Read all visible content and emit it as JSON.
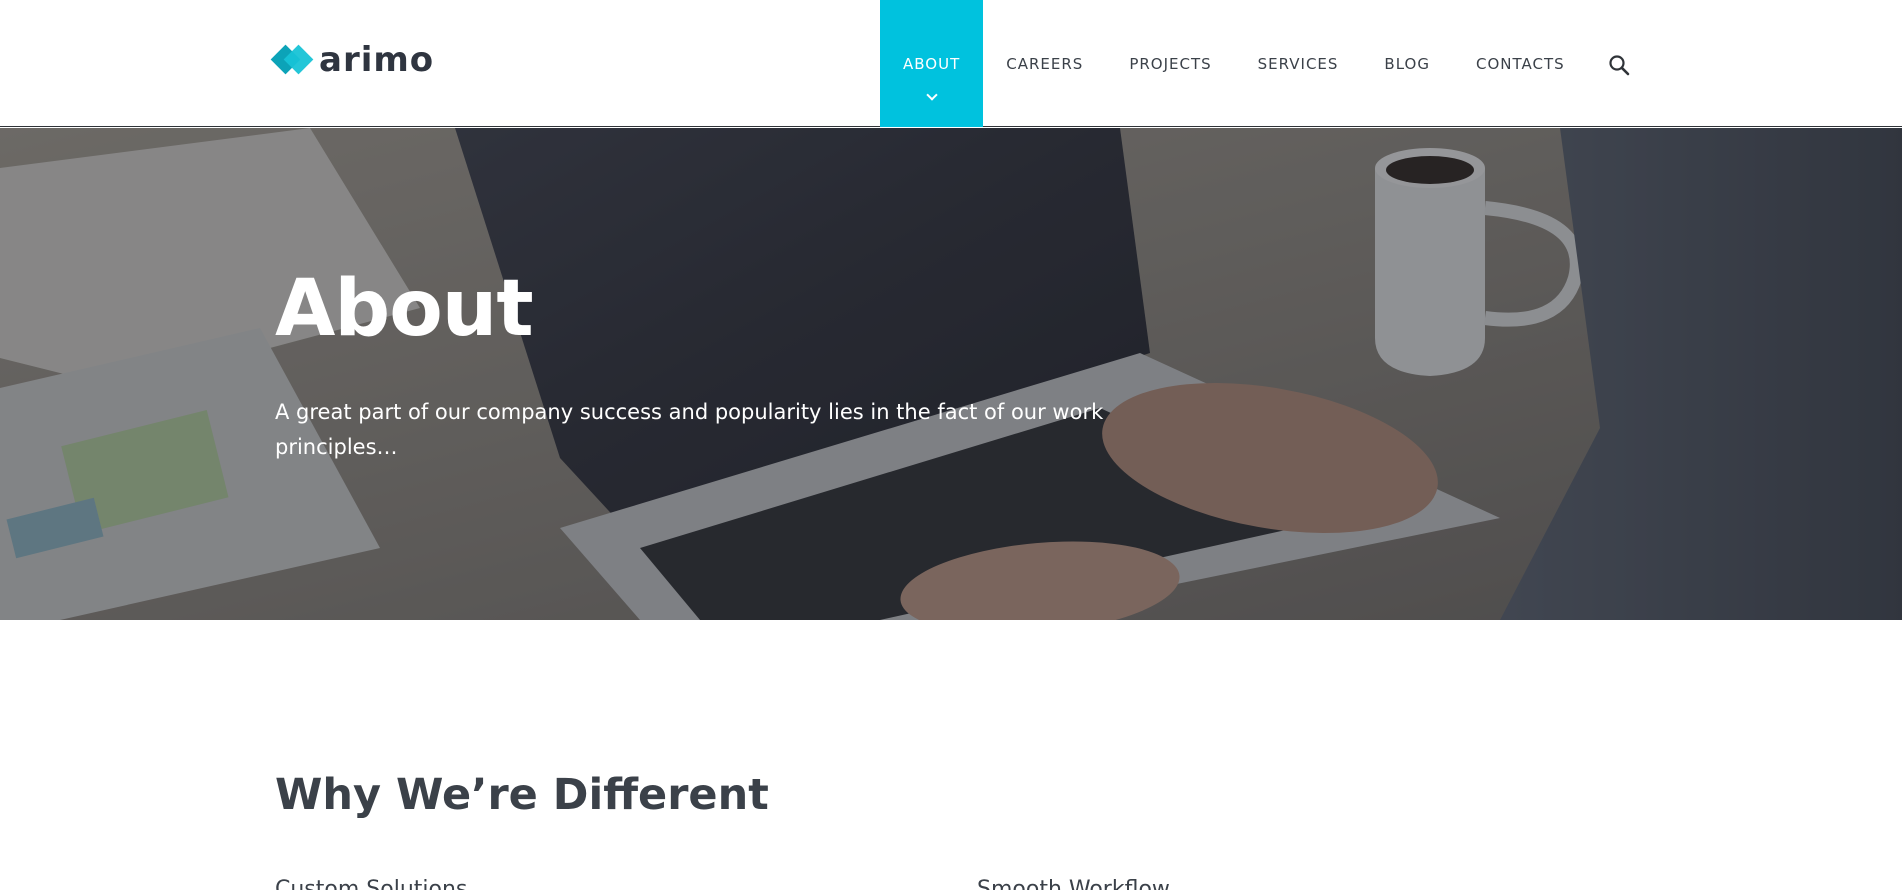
{
  "brand": {
    "name": "arimo"
  },
  "nav": {
    "items": [
      {
        "label": "ABOUT",
        "active": true
      },
      {
        "label": "CAREERS",
        "active": false
      },
      {
        "label": "PROJECTS",
        "active": false
      },
      {
        "label": "SERVICES",
        "active": false
      },
      {
        "label": "BLOG",
        "active": false
      },
      {
        "label": "CONTACTS",
        "active": false
      }
    ],
    "search_icon": "search-icon"
  },
  "hero": {
    "title": "About",
    "subtitle": "A great part of our company success and popularity lies in the fact of our work principles…"
  },
  "section": {
    "title": "Why We’re Different",
    "columns": [
      {
        "title": "Custom Solutions"
      },
      {
        "title": "Smooth Workflow"
      }
    ]
  },
  "colors": {
    "accent": "#00c2de",
    "text": "#3b4149",
    "logo_mark": "#0ca3b8"
  }
}
